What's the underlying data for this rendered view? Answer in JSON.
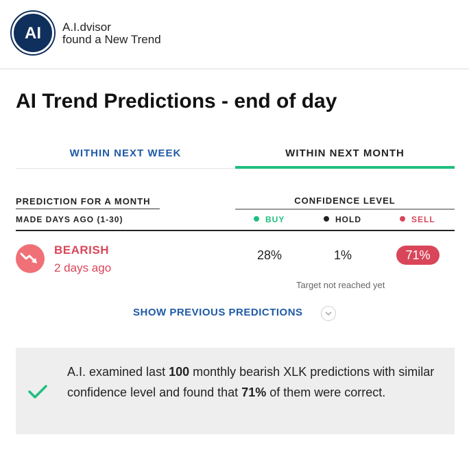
{
  "header": {
    "avatar_text": "AI",
    "brand_name": "A.I.dvisor",
    "brand_subtitle": "found a New Trend"
  },
  "title": "AI Trend Predictions - end of day",
  "tabs": [
    {
      "label": "WITHIN NEXT WEEK",
      "active": false
    },
    {
      "label": "WITHIN NEXT MONTH",
      "active": true
    }
  ],
  "columns": {
    "prediction_header": "PREDICTION FOR A MONTH",
    "made_days_ago": "MADE DAYS AGO (1-30)",
    "confidence_header": "CONFIDENCE LEVEL"
  },
  "legend": {
    "buy": "BUY",
    "hold": "HOLD",
    "sell": "SELL"
  },
  "prediction": {
    "direction": "BEARISH",
    "made": "2 days ago",
    "buy_pct": "28%",
    "hold_pct": "1%",
    "sell_pct": "71%",
    "target_status": "Target not reached yet"
  },
  "show_previous": "SHOW PREVIOUS PREDICTIONS",
  "summary": {
    "part1": "A.I. examined last ",
    "count": "100",
    "part2": " monthly bearish XLK predictions with similar confidence level and found that ",
    "accuracy": "71%",
    "part3": " of them were correct."
  },
  "colors": {
    "accent_blue": "#1f5aa6",
    "active_tab_underline": "#1fbf7f",
    "sell_red": "#d9465a",
    "avatar_navy": "#0f2f5c"
  },
  "icons": [
    "bearish-trend-icon",
    "chevron-down-icon",
    "checkmark-icon"
  ]
}
